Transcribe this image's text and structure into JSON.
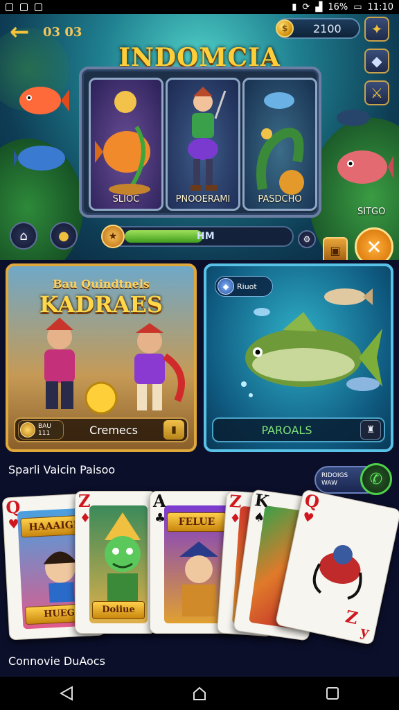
{
  "status_bar": {
    "signal": "16%",
    "time": "11:10"
  },
  "header": {
    "back_text": "03 03",
    "coins": "2100",
    "title": "INDOMCIA"
  },
  "slots": [
    {
      "label": "SLIOC"
    },
    {
      "label": "PNOOERAMI"
    },
    {
      "label": "PASDCHO"
    }
  ],
  "progress": {
    "text": "HM",
    "fill": 0.48
  },
  "side": {
    "label": "SITGO"
  },
  "promo_left": {
    "title_small": "Bau Quindtnels",
    "title_big": "KADRAES",
    "badge_line1": "BAU",
    "badge_line2": "111",
    "footer_label": "Cremecs"
  },
  "promo_right": {
    "chip_text": "Riuot",
    "footer_label": "PAROALS"
  },
  "section1": {
    "label": "Sparli Vaicin Paisoo"
  },
  "pill": {
    "line1": "RIDOIGS",
    "line2": "WAW"
  },
  "cards": [
    {
      "rank": "Q",
      "suit": "♥",
      "color": "red",
      "ribbon_top": "HAAAIGE",
      "ribbon_bottom": "HUEG"
    },
    {
      "rank": "Z",
      "suit": "♦",
      "color": "red",
      "ribbon_bottom": "Doiiue"
    },
    {
      "rank": "A",
      "suit": "♣",
      "color": "blk",
      "ribbon_top": "FELUE"
    },
    {
      "rank": "Z",
      "suit": "♦",
      "color": "red"
    },
    {
      "rank": "K",
      "suit": "♠",
      "color": "blk"
    },
    {
      "rank": "Q",
      "suit": "♥",
      "color": "red",
      "rank_bottom": "Z",
      "rank_bottom2": "y"
    }
  ],
  "section2": {
    "label": "Connovie DuAocs"
  },
  "colors": {
    "gold": "#ffcf3a",
    "accent_blue": "#59c2e6",
    "green": "#4fd04a"
  }
}
